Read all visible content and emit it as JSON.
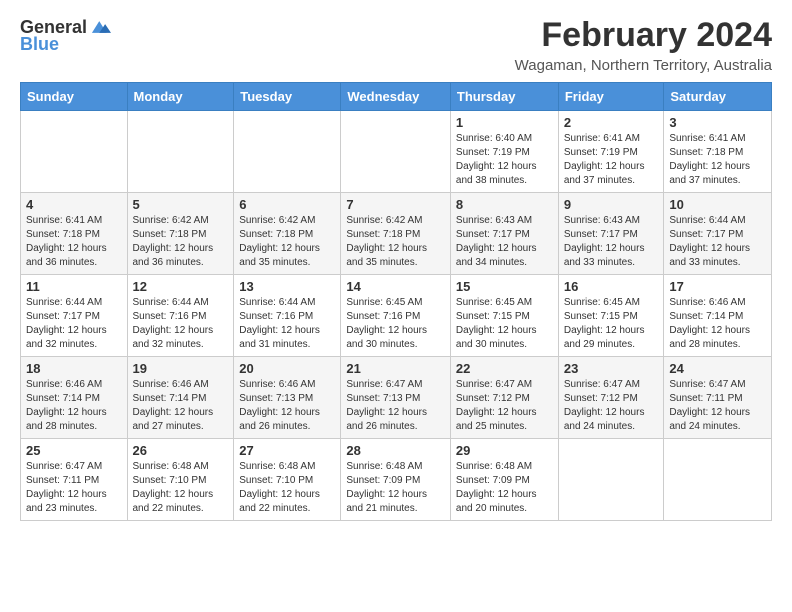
{
  "header": {
    "logo_general": "General",
    "logo_blue": "Blue",
    "month_year": "February 2024",
    "location": "Wagaman, Northern Territory, Australia"
  },
  "days_of_week": [
    "Sunday",
    "Monday",
    "Tuesday",
    "Wednesday",
    "Thursday",
    "Friday",
    "Saturday"
  ],
  "weeks": [
    [
      {
        "day": "",
        "info": ""
      },
      {
        "day": "",
        "info": ""
      },
      {
        "day": "",
        "info": ""
      },
      {
        "day": "",
        "info": ""
      },
      {
        "day": "1",
        "info": "Sunrise: 6:40 AM\nSunset: 7:19 PM\nDaylight: 12 hours\nand 38 minutes."
      },
      {
        "day": "2",
        "info": "Sunrise: 6:41 AM\nSunset: 7:19 PM\nDaylight: 12 hours\nand 37 minutes."
      },
      {
        "day": "3",
        "info": "Sunrise: 6:41 AM\nSunset: 7:18 PM\nDaylight: 12 hours\nand 37 minutes."
      }
    ],
    [
      {
        "day": "4",
        "info": "Sunrise: 6:41 AM\nSunset: 7:18 PM\nDaylight: 12 hours\nand 36 minutes."
      },
      {
        "day": "5",
        "info": "Sunrise: 6:42 AM\nSunset: 7:18 PM\nDaylight: 12 hours\nand 36 minutes."
      },
      {
        "day": "6",
        "info": "Sunrise: 6:42 AM\nSunset: 7:18 PM\nDaylight: 12 hours\nand 35 minutes."
      },
      {
        "day": "7",
        "info": "Sunrise: 6:42 AM\nSunset: 7:18 PM\nDaylight: 12 hours\nand 35 minutes."
      },
      {
        "day": "8",
        "info": "Sunrise: 6:43 AM\nSunset: 7:17 PM\nDaylight: 12 hours\nand 34 minutes."
      },
      {
        "day": "9",
        "info": "Sunrise: 6:43 AM\nSunset: 7:17 PM\nDaylight: 12 hours\nand 33 minutes."
      },
      {
        "day": "10",
        "info": "Sunrise: 6:44 AM\nSunset: 7:17 PM\nDaylight: 12 hours\nand 33 minutes."
      }
    ],
    [
      {
        "day": "11",
        "info": "Sunrise: 6:44 AM\nSunset: 7:17 PM\nDaylight: 12 hours\nand 32 minutes."
      },
      {
        "day": "12",
        "info": "Sunrise: 6:44 AM\nSunset: 7:16 PM\nDaylight: 12 hours\nand 32 minutes."
      },
      {
        "day": "13",
        "info": "Sunrise: 6:44 AM\nSunset: 7:16 PM\nDaylight: 12 hours\nand 31 minutes."
      },
      {
        "day": "14",
        "info": "Sunrise: 6:45 AM\nSunset: 7:16 PM\nDaylight: 12 hours\nand 30 minutes."
      },
      {
        "day": "15",
        "info": "Sunrise: 6:45 AM\nSunset: 7:15 PM\nDaylight: 12 hours\nand 30 minutes."
      },
      {
        "day": "16",
        "info": "Sunrise: 6:45 AM\nSunset: 7:15 PM\nDaylight: 12 hours\nand 29 minutes."
      },
      {
        "day": "17",
        "info": "Sunrise: 6:46 AM\nSunset: 7:14 PM\nDaylight: 12 hours\nand 28 minutes."
      }
    ],
    [
      {
        "day": "18",
        "info": "Sunrise: 6:46 AM\nSunset: 7:14 PM\nDaylight: 12 hours\nand 28 minutes."
      },
      {
        "day": "19",
        "info": "Sunrise: 6:46 AM\nSunset: 7:14 PM\nDaylight: 12 hours\nand 27 minutes."
      },
      {
        "day": "20",
        "info": "Sunrise: 6:46 AM\nSunset: 7:13 PM\nDaylight: 12 hours\nand 26 minutes."
      },
      {
        "day": "21",
        "info": "Sunrise: 6:47 AM\nSunset: 7:13 PM\nDaylight: 12 hours\nand 26 minutes."
      },
      {
        "day": "22",
        "info": "Sunrise: 6:47 AM\nSunset: 7:12 PM\nDaylight: 12 hours\nand 25 minutes."
      },
      {
        "day": "23",
        "info": "Sunrise: 6:47 AM\nSunset: 7:12 PM\nDaylight: 12 hours\nand 24 minutes."
      },
      {
        "day": "24",
        "info": "Sunrise: 6:47 AM\nSunset: 7:11 PM\nDaylight: 12 hours\nand 24 minutes."
      }
    ],
    [
      {
        "day": "25",
        "info": "Sunrise: 6:47 AM\nSunset: 7:11 PM\nDaylight: 12 hours\nand 23 minutes."
      },
      {
        "day": "26",
        "info": "Sunrise: 6:48 AM\nSunset: 7:10 PM\nDaylight: 12 hours\nand 22 minutes."
      },
      {
        "day": "27",
        "info": "Sunrise: 6:48 AM\nSunset: 7:10 PM\nDaylight: 12 hours\nand 22 minutes."
      },
      {
        "day": "28",
        "info": "Sunrise: 6:48 AM\nSunset: 7:09 PM\nDaylight: 12 hours\nand 21 minutes."
      },
      {
        "day": "29",
        "info": "Sunrise: 6:48 AM\nSunset: 7:09 PM\nDaylight: 12 hours\nand 20 minutes."
      },
      {
        "day": "",
        "info": ""
      },
      {
        "day": "",
        "info": ""
      }
    ]
  ]
}
